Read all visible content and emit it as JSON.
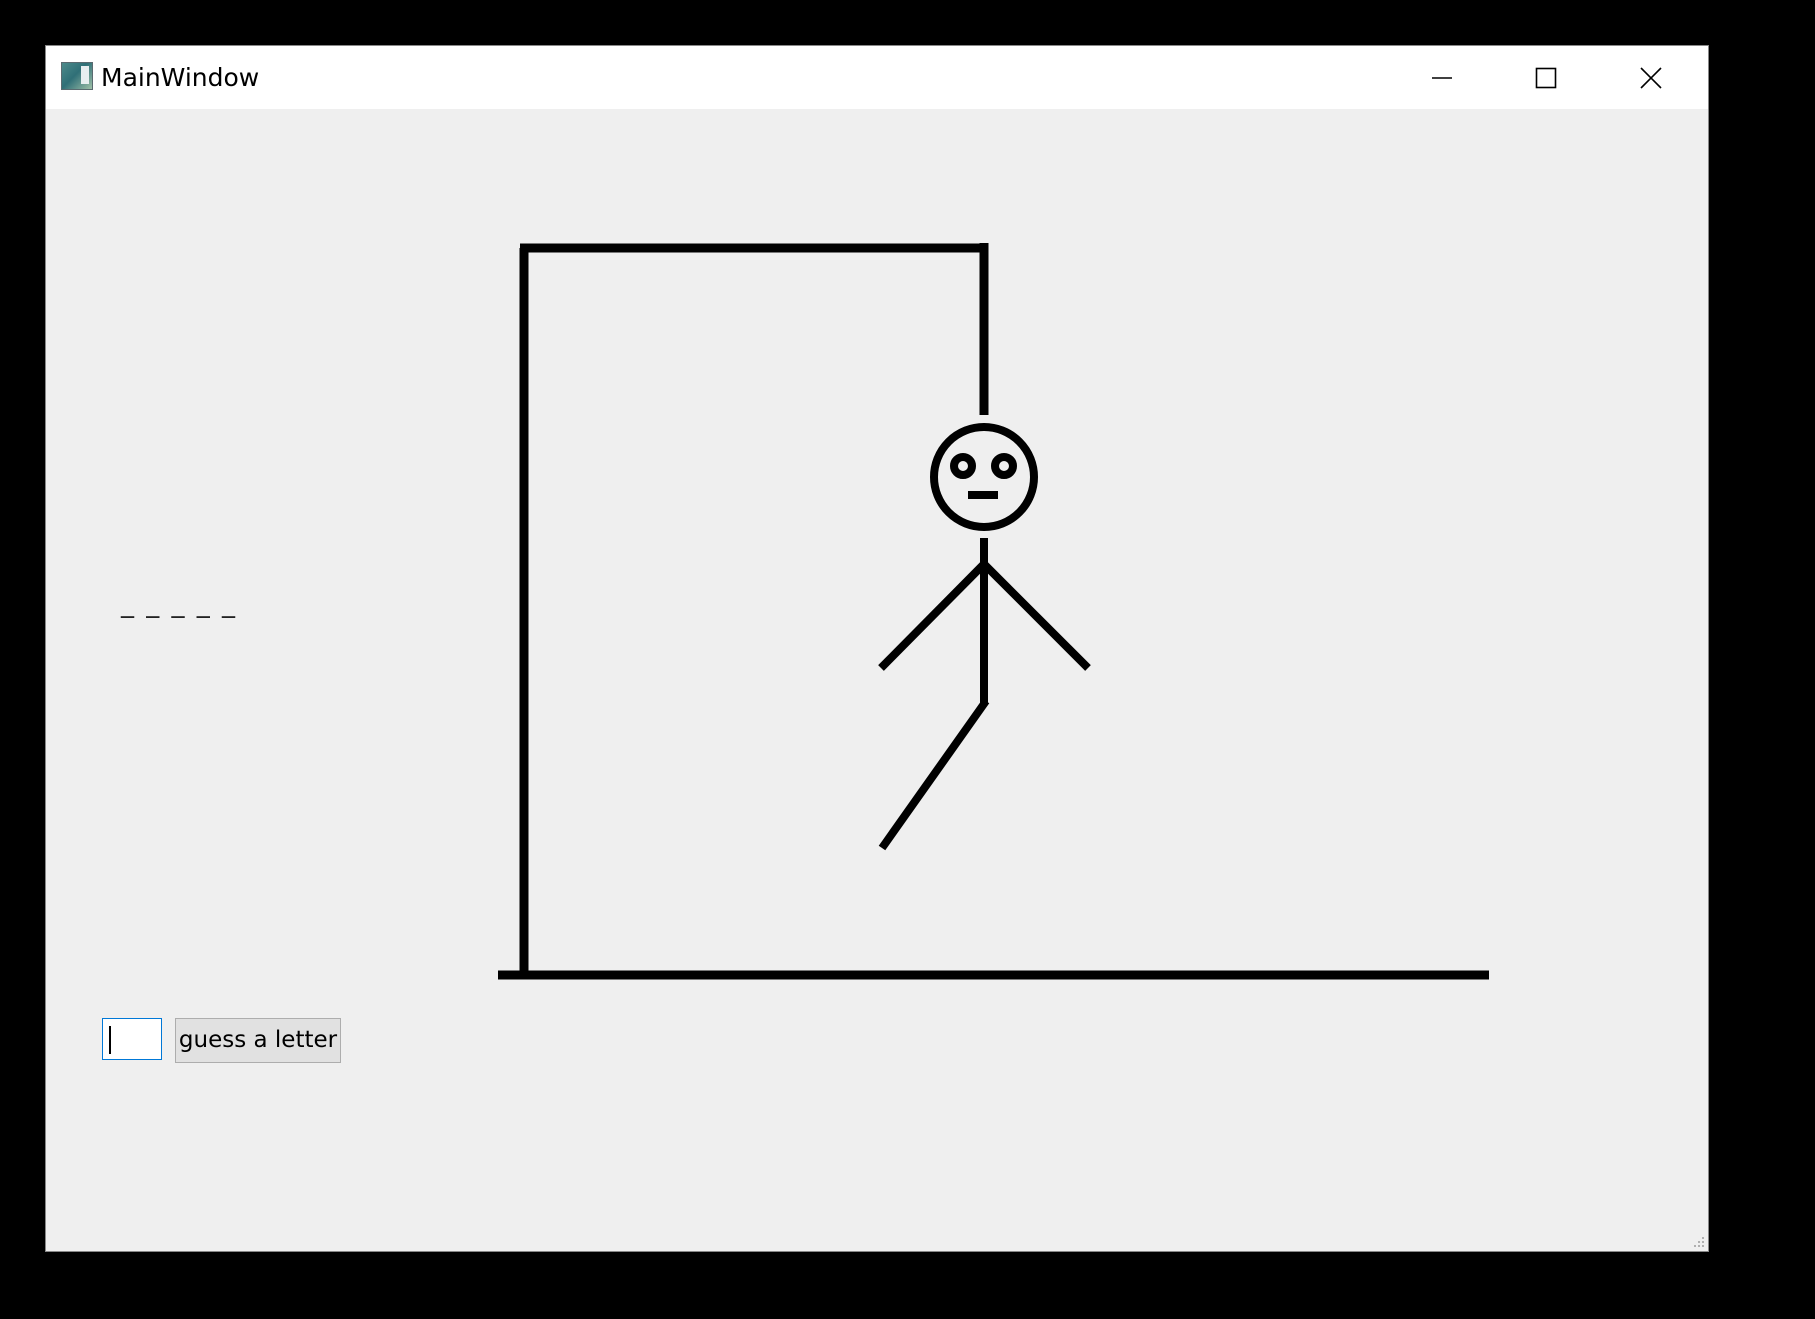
{
  "window": {
    "title": "MainWindow",
    "icon": "app-icon",
    "buttons": {
      "minimize_icon": "minimize-icon",
      "maximize_icon": "maximize-icon",
      "close_icon": "close-icon"
    }
  },
  "game": {
    "word_display": "_ _ _ _ _",
    "word_length": 5,
    "parts_drawn": [
      "gallows",
      "head",
      "body",
      "left-arm",
      "right-arm",
      "left-leg"
    ],
    "letter_input": {
      "value": "",
      "placeholder": ""
    },
    "guess_button_label": "guess a letter"
  },
  "colors": {
    "window_bg": "#efefef",
    "titlebar_bg": "#ffffff",
    "ink": "#000000",
    "focus_border": "#0078d7",
    "button_bg": "#e1e1e1"
  }
}
